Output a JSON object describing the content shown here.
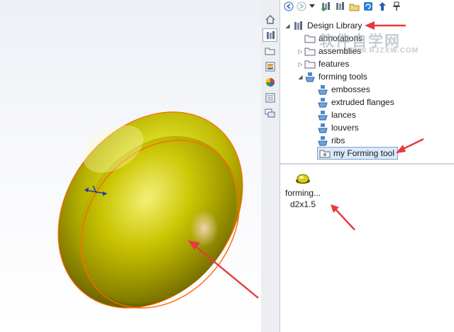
{
  "viewport": {
    "object": "embossed-dome",
    "accent": "#c9a600",
    "edge_color": "#ff6a00"
  },
  "tabs": [
    {
      "name": "home-tab",
      "icon": "home-icon"
    },
    {
      "name": "design-library-tab",
      "icon": "library-icon",
      "active": true
    },
    {
      "name": "file-explorer-tab",
      "icon": "folder-icon"
    },
    {
      "name": "view-palette-tab",
      "icon": "view-palette-icon"
    },
    {
      "name": "appearances-tab",
      "icon": "appearances-icon"
    },
    {
      "name": "custom-properties-tab",
      "icon": "properties-icon"
    },
    {
      "name": "forum-tab",
      "icon": "forum-icon"
    }
  ],
  "toolbar": {
    "buttons": [
      "back-icon",
      "forward-icon",
      "dropdown-icon",
      "add-to-library-icon",
      "add-file-location-icon",
      "create-folder-icon",
      "refresh-icon",
      "up-icon",
      "pin-icon"
    ]
  },
  "tree": {
    "root": "Design Library",
    "items": [
      {
        "label": "annotations"
      },
      {
        "label": "assemblies"
      },
      {
        "label": "features"
      },
      {
        "label": "forming tools"
      }
    ],
    "forming_tools": [
      {
        "label": "embosses"
      },
      {
        "label": "extruded flanges"
      },
      {
        "label": "lances"
      },
      {
        "label": "louvers"
      },
      {
        "label": "ribs"
      },
      {
        "label": "my Forming tool"
      }
    ]
  },
  "files": [
    {
      "label_line1": "forming...",
      "label_line2": "d2x1.5"
    }
  ],
  "watermark": {
    "line1": "软件自学网",
    "line2": "WWW.RJZXW.COM"
  },
  "annotation_color": "#e8393c"
}
